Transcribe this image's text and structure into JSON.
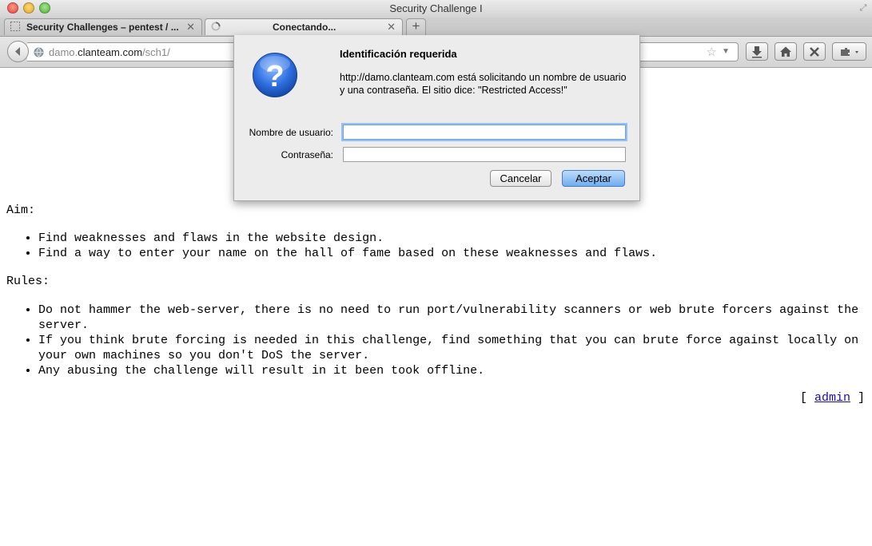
{
  "window": {
    "title": "Security Challenge I"
  },
  "tabs": [
    {
      "label": "Security Challenges – pentest / ...",
      "close": "✕",
      "favicon": "dashed-square-icon"
    },
    {
      "label": "Conectando...",
      "close": "✕",
      "favicon": "loading-spinner-icon"
    }
  ],
  "new_tab_label": "+",
  "address": {
    "host_prefix": "damo.",
    "host": "clanteam.com",
    "path": "/sch1/"
  },
  "dialog": {
    "title": "Identificación requerida",
    "message": "http://damo.clanteam.com está solicitando un nombre de usuario y una contraseña. El sitio dice: \"Restricted Access!\"",
    "username_label": "Nombre de usuario:",
    "username_value": "",
    "password_label": "Contraseña:",
    "password_value": "",
    "cancel_label": "Cancelar",
    "ok_label": "Aceptar",
    "icon": "question-mark-icon"
  },
  "page": {
    "aim_label": "Aim:",
    "aim_items": [
      "Find weaknesses and flaws in the website design.",
      "Find a way to enter your name on the hall of fame based on these weaknesses and flaws."
    ],
    "rules_label": "Rules:",
    "rules_items": [
      "Do not hammer the web-server, there is no need to run port/vulnerability scanners or web brute forcers against the server.",
      "If you think brute forcing is needed in this challenge, find something that you can brute force against locally on your own machines so you don't DoS the server.",
      "Any abusing the challenge will result in it been took offline."
    ],
    "admin_open": "[ ",
    "admin_link": "admin",
    "admin_close": " ]"
  },
  "colors": {
    "link": "#1a0dab",
    "focus_ring": "#94c0f3",
    "default_button": "#6fadef"
  }
}
